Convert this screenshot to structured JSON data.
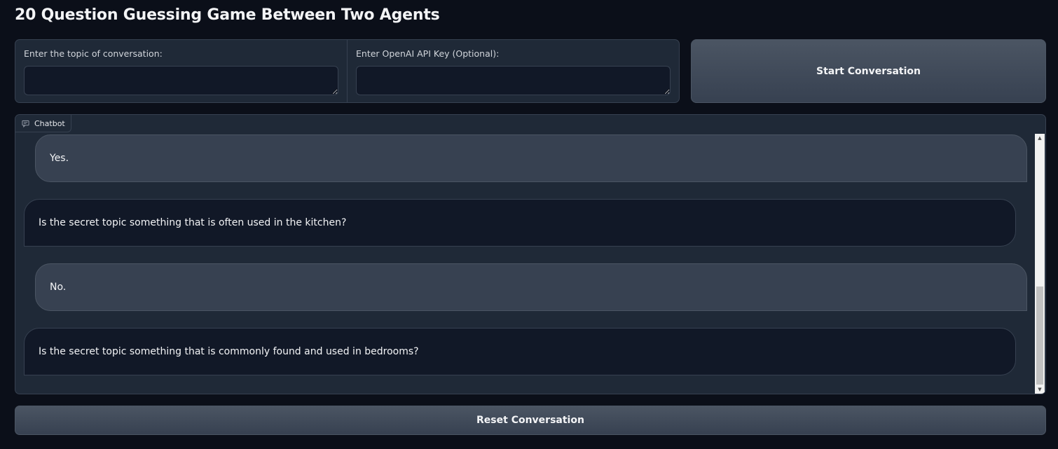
{
  "page": {
    "title": "20 Question Guessing Game Between Two Agents"
  },
  "inputs": {
    "topic": {
      "label": "Enter the topic of conversation:",
      "value": "",
      "placeholder": ""
    },
    "api_key": {
      "label": "Enter OpenAI API Key (Optional):",
      "value": "",
      "placeholder": ""
    }
  },
  "buttons": {
    "start": "Start Conversation",
    "reset": "Reset Conversation"
  },
  "chatbot": {
    "label": "Chatbot",
    "icon": "chat-bubble-icon",
    "messages": [
      {
        "role": "bot",
        "text": "Yes."
      },
      {
        "role": "user",
        "text": "Is the secret topic something that is often used in the kitchen?"
      },
      {
        "role": "bot",
        "text": "No."
      },
      {
        "role": "user",
        "text": "Is the secret topic something that is commonly found and used in bedrooms?"
      }
    ]
  },
  "theme": {
    "background": "#0b0f19",
    "panel": "#1f2937",
    "bot_bubble": "#374151",
    "user_bubble": "#111827",
    "border": "#374151"
  }
}
